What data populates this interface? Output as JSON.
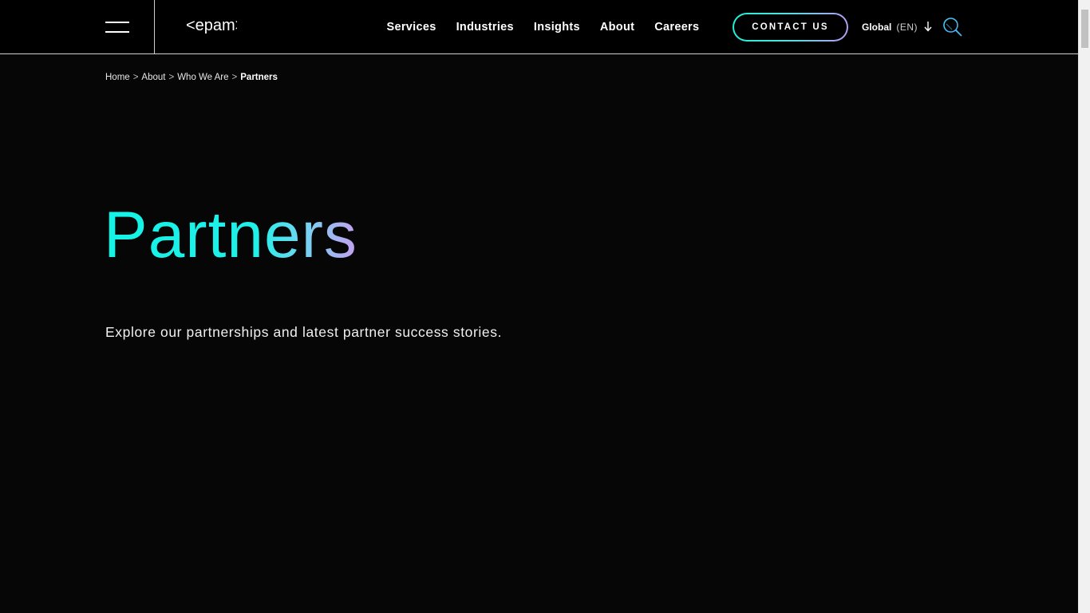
{
  "header": {
    "logo_text": "<epam>",
    "nav": [
      {
        "label": "Services"
      },
      {
        "label": "Industries"
      },
      {
        "label": "Insights"
      },
      {
        "label": "About"
      },
      {
        "label": "Careers"
      }
    ],
    "contact_label": "CONTACT US",
    "language": {
      "name": "Global",
      "code": "(EN)"
    }
  },
  "breadcrumb": {
    "items": [
      "Home",
      "About",
      "Who We Are"
    ],
    "separator": ">",
    "current": "Partners"
  },
  "hero": {
    "title": "Partners",
    "subtitle": "Explore our partnerships and latest partner success stories."
  },
  "colors": {
    "background": "#060606",
    "header_bg": "#000000",
    "accent_cyan": "#14f2e6",
    "accent_violet": "#c59ff0"
  },
  "icons": {
    "menu": "hamburger-icon",
    "language_arrow": "arrow-down-icon",
    "search": "search-icon"
  }
}
